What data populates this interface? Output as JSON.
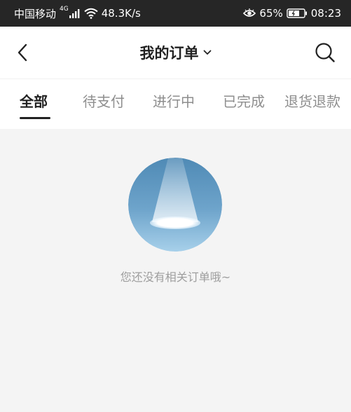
{
  "status_bar": {
    "carrier": "中国移动",
    "network_type": "4G",
    "speed": "48.3K/s",
    "battery": "65%",
    "time": "08:23"
  },
  "header": {
    "title": "我的订单",
    "back_icon": "chevron-left-icon",
    "dropdown_icon": "chevron-down-icon",
    "search_icon": "search-icon"
  },
  "tabs": [
    {
      "label": "全部",
      "active": true
    },
    {
      "label": "待支付",
      "active": false
    },
    {
      "label": "进行中",
      "active": false
    },
    {
      "label": "已完成",
      "active": false
    },
    {
      "label": "退货退款",
      "active": false
    }
  ],
  "empty_state": {
    "illustration": "spotlight-icon",
    "message": "您还没有相关订单哦~"
  },
  "colors": {
    "status_bar_bg": "#262626",
    "page_bg": "#f4f4f4",
    "active_tab": "#222222",
    "inactive_tab": "#8e8e8e",
    "empty_text": "#9e9e9e"
  }
}
